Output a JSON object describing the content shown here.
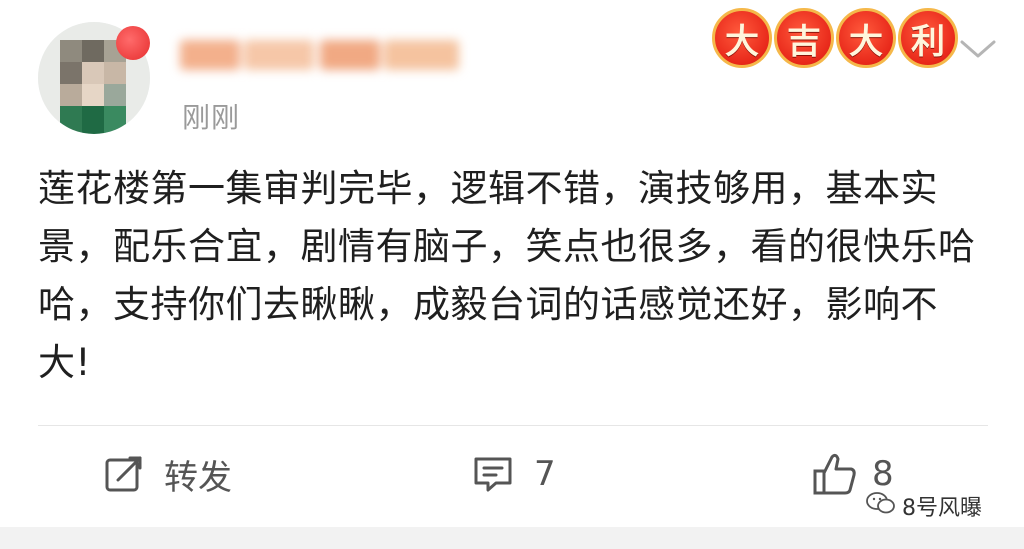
{
  "post": {
    "time": "刚刚",
    "badges": [
      "大",
      "吉",
      "大",
      "利"
    ],
    "content": "莲花楼第一集审判完毕，逻辑不错，演技够用，基本实景，配乐合宜，剧情有脑子，笑点也很多，看的很快乐哈哈，支持你们去瞅瞅，成毅台词的话感觉还好，影响不大!"
  },
  "actions": {
    "repost_label": "转发",
    "comment_count": "7",
    "like_count": "8"
  },
  "watermark": {
    "text": "8号风曝"
  },
  "icons": {
    "avatar": "avatar",
    "more": "chevron-down-icon",
    "repost": "repost-icon",
    "comment": "comment-icon",
    "like": "thumbs-up-icon",
    "watermark": "wechat-icon"
  },
  "colors": {
    "badge_red": "#e8281a",
    "badge_border": "#f5b84a",
    "time_gray": "#9a9a9a",
    "text": "#1f1f1f"
  }
}
